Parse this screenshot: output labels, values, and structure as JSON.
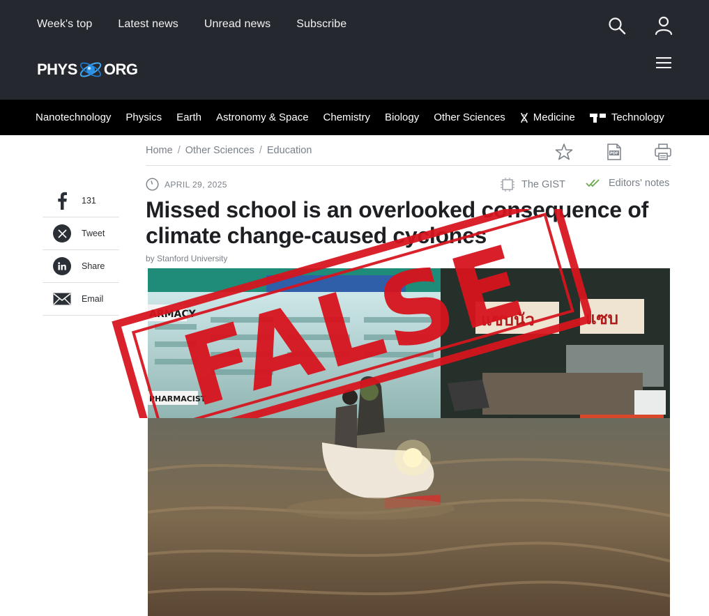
{
  "header": {
    "nav": [
      "Week's top",
      "Latest news",
      "Unread news",
      "Subscribe"
    ],
    "logo_left": "PHYS",
    "logo_right": "ORG"
  },
  "categories": [
    "Nanotechnology",
    "Physics",
    "Earth",
    "Astronomy & Space",
    "Chemistry",
    "Biology",
    "Other Sciences",
    "Medicine",
    "Technology"
  ],
  "breadcrumb": [
    "Home",
    "Other Sciences",
    "Education"
  ],
  "article": {
    "date": "APRIL 29, 2025",
    "gist_label": "The GIST",
    "editors_label": "Editors' notes",
    "title": "Missed school is an overlooked consequence of climate change-caused cyclones",
    "byline": "by Stanford University"
  },
  "share": {
    "facebook_count": "131",
    "tweet": "Tweet",
    "share": "Share",
    "email": "Email"
  },
  "hero": {
    "sign_pharmacy": "ARMACY",
    "sign_pharmacist": "PHARMACIST",
    "sign_right_1": "แซบนัว",
    "sign_right_2": "แซบ"
  },
  "stamp": {
    "text": "FALSE",
    "color": "#d7141e"
  },
  "colors": {
    "header_bg": "#25292f",
    "catbar_bg": "#000000",
    "meta_gray": "#7a8088"
  }
}
